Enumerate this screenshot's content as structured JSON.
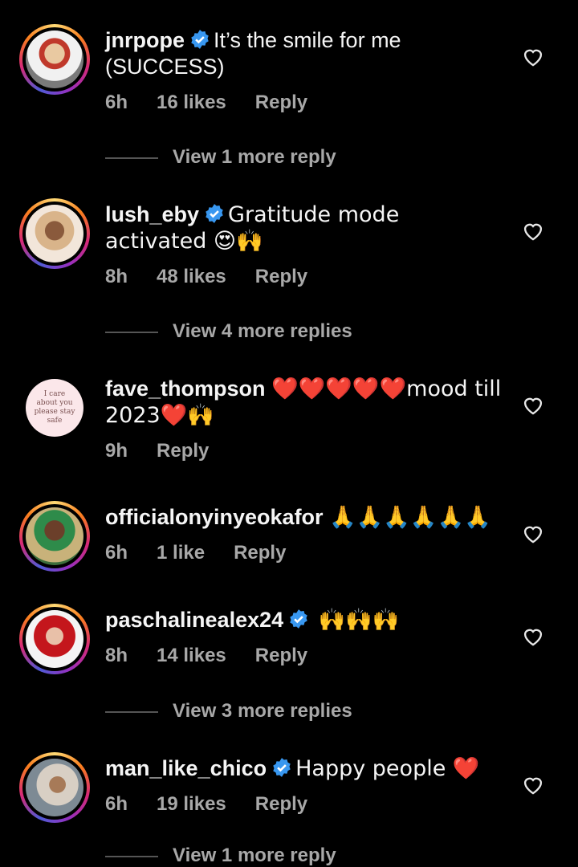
{
  "comments": [
    {
      "username": "jnrpope",
      "verified": true,
      "text": "It’s the smile for me (SUCCESS)",
      "time": "6h",
      "likes": "16 likes",
      "reply": "Reply",
      "view_more": "View 1 more reply"
    },
    {
      "username": "lush_eby",
      "verified": true,
      "text": "Gratitude mode activated 😍🙌",
      "time": "8h",
      "likes": "48 likes",
      "reply": "Reply",
      "view_more": "View 4 more replies"
    },
    {
      "username": "fave_thompson",
      "verified": false,
      "text": "❤️❤️❤️❤️❤️mood till 2023❤️🙌",
      "time": "9h",
      "reply": "Reply",
      "avatar_text": [
        "I care",
        "about you",
        "please stay",
        "safe"
      ]
    },
    {
      "username": "officialonyinyeokafor",
      "verified": false,
      "text": "🙏🙏🙏🙏🙏🙏",
      "time": "6h",
      "likes": "1 like",
      "reply": "Reply"
    },
    {
      "username": "paschalinealex24",
      "verified": true,
      "text": "🙌🙌🙌",
      "time": "8h",
      "likes": "14 likes",
      "reply": "Reply",
      "view_more": "View 3 more replies"
    },
    {
      "username": "man_like_chico",
      "verified": true,
      "text": "Happy people ❤️",
      "time": "6h",
      "likes": "19 likes",
      "reply": "Reply",
      "view_more": "View 1 more reply"
    }
  ],
  "icons": {
    "verified": "verified-badge-icon",
    "like": "heart-outline-icon"
  },
  "colors": {
    "background": "#000000",
    "text": "#f5f5f5",
    "muted": "#a8a8a8",
    "verified": "#3897f0"
  }
}
